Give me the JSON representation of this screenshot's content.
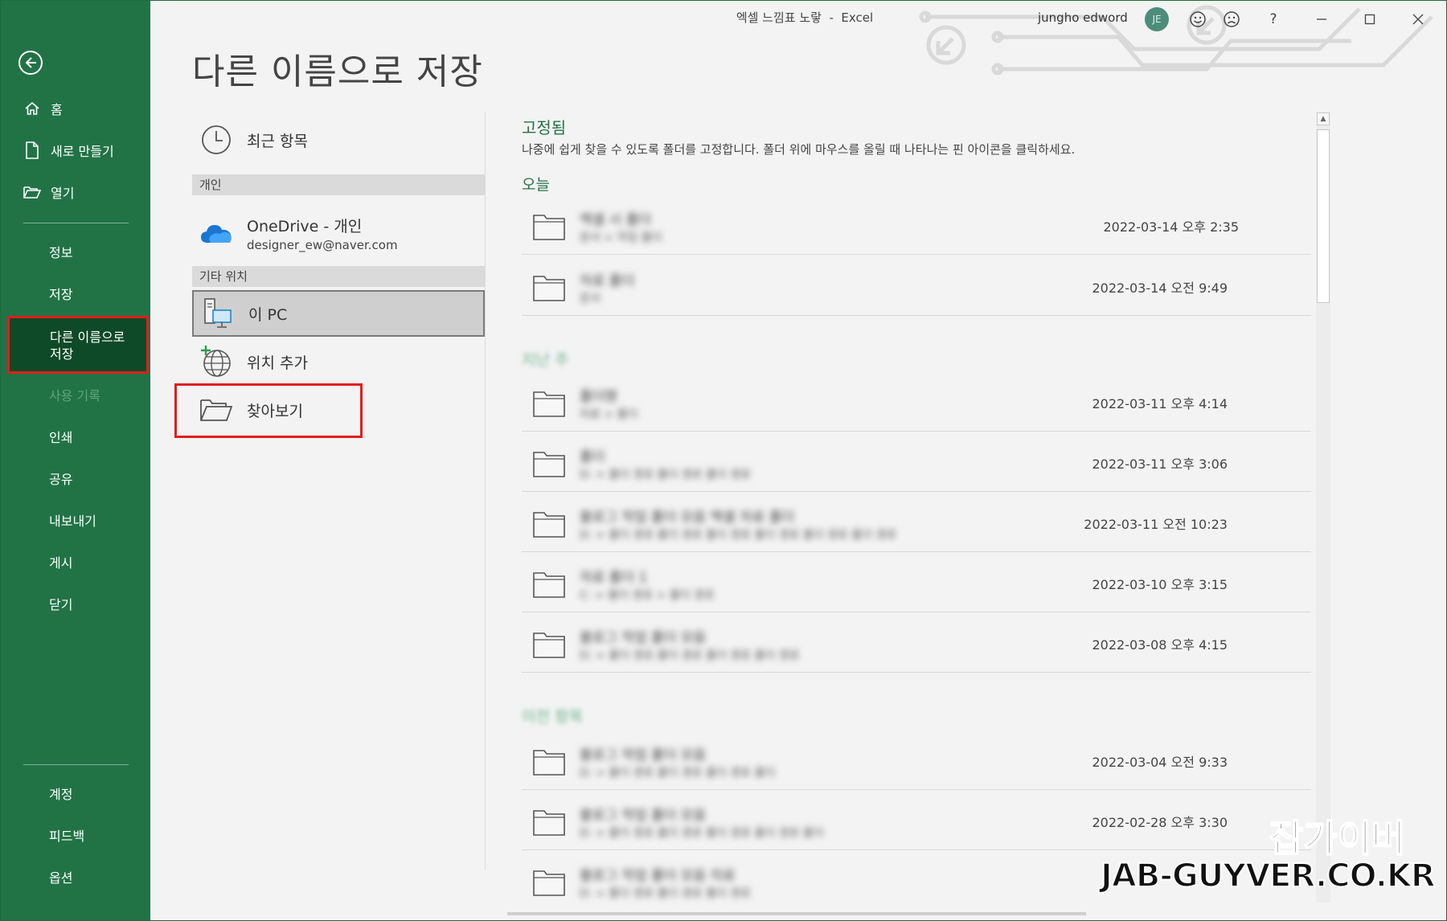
{
  "window": {
    "title": "엑셀 느낌표 노랗  -  Excel",
    "user_name": "jungho edword",
    "avatar_initials": "JE",
    "help_label": "?"
  },
  "colors": {
    "accent": "#217346",
    "active_sidebar": "#0e4a27",
    "highlight_box": "#e11d1d"
  },
  "sidebar": {
    "items": [
      {
        "label": "홈",
        "icon": "home-icon"
      },
      {
        "label": "새로 만들기",
        "icon": "new-file-icon"
      },
      {
        "label": "열기",
        "icon": "folder-open-icon"
      },
      {
        "label": "정보"
      },
      {
        "label": "저장"
      },
      {
        "label": "다른 이름으로\n저장",
        "active": true
      },
      {
        "label": "사용 기록",
        "disabled": true
      },
      {
        "label": "인쇄"
      },
      {
        "label": "공유"
      },
      {
        "label": "내보내기"
      },
      {
        "label": "게시"
      },
      {
        "label": "닫기"
      },
      {
        "label": "계정"
      },
      {
        "label": "피드백"
      },
      {
        "label": "옵션"
      }
    ]
  },
  "page": {
    "title": "다른 이름으로 저장"
  },
  "locations": {
    "recent": "최근 항목",
    "personal_header": "개인",
    "onedrive_name": "OneDrive - 개인",
    "onedrive_email": "designer_ew@naver.com",
    "other_header": "기타 위치",
    "this_pc": "이 PC",
    "add_place": "위치 추가",
    "browse": "찾아보기"
  },
  "pinned": {
    "title": "고정됨",
    "description": "나중에 쉽게 찾을 수 있도록 폴더를 고정합니다. 폴더 위에 마우스를 올릴 때 나타나는 핀 아이콘을 클릭하세요.",
    "groups": [
      {
        "label": "오늘",
        "blurred": false,
        "rows": [
          {
            "name": "엑셀 시 폴더",
            "path": "문서 > 작업 폴더",
            "date": "2022-03-14 오후 2:35"
          },
          {
            "name": "자료 폴더",
            "path": "문서",
            "date": "2022-03-14 오전 9:49"
          }
        ]
      },
      {
        "label": "지난 주",
        "blurred": true,
        "rows": [
          {
            "name": "폴더명",
            "path": "자료 > 폴더",
            "date": "2022-03-11 오후 4:14"
          },
          {
            "name": "폴더",
            "path": "D: > 폴더 경로 폴더 경로 폴더 경로",
            "date": "2022-03-11 오후 3:06"
          },
          {
            "name": "블로그 작업 폴더 모음 엑셀 자료 폴더",
            "path": "D: > 폴더 경로 폴더 경로 폴더 경로 폴더 경로 폴더 경로 폴더 경로",
            "date": "2022-03-11 오전 10:23"
          },
          {
            "name": "자료 폴더 1",
            "path": "C: > 폴더 경로 > 폴더 경로",
            "date": "2022-03-10 오후 3:15"
          },
          {
            "name": "블로그 작업 폴더 모음",
            "path": "D: > 폴더 경로 폴더 경로 폴더 경로 폴더 경로",
            "date": "2022-03-08 오후 4:15"
          }
        ]
      },
      {
        "label": "이전 항목",
        "blurred": true,
        "rows": [
          {
            "name": "블로그 작업 폴더 모음",
            "path": "D: > 폴더 경로 폴더 경로 폴더 경로 폴더",
            "date": "2022-03-04 오전 9:33"
          },
          {
            "name": "블로그 작업 폴더 모음",
            "path": "D: > 폴더 경로 폴더 경로 폴더 경로 폴더 경로 폴더",
            "date": "2022-02-28 오후 3:30"
          },
          {
            "name": "블로그 작업 폴더 모음 자료",
            "path": "D: > 폴더 경로 폴더 경로 폴더 경로",
            "date": ""
          }
        ]
      }
    ]
  },
  "watermark": {
    "line1": "잡가이버",
    "line2": "JAB-GUYVER.CO.KR"
  }
}
